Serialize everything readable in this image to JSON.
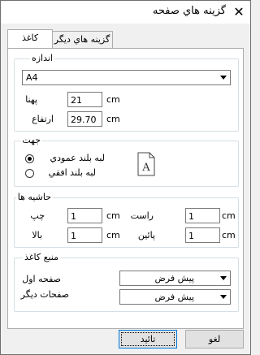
{
  "window": {
    "title": "گزينه هاي صفحه",
    "close_glyph": "✕"
  },
  "tabs": [
    {
      "label": "كاغذ",
      "active": true
    },
    {
      "label": "گزينه هاي ديگر",
      "active": false
    }
  ],
  "size_group": {
    "legend": "اندازه",
    "paper_size": "A4",
    "width_label": "پهنا",
    "width_value": "21",
    "width_unit": "cm",
    "height_label": "ارتفاع",
    "height_value": "29.70",
    "height_unit": "cm"
  },
  "orientation_group": {
    "legend": "جهت",
    "portrait_label": "لبه بلند عمودي",
    "landscape_label": "لبه بلند افقي",
    "selected": "portrait",
    "preview_letter": "A",
    "preview_icon": "page-portrait-icon"
  },
  "margins_group": {
    "legend": "حاشيه ها",
    "right_label": "راست",
    "right_value": "1",
    "left_label": "چپ",
    "left_value": "1",
    "bottom_label": "پائين",
    "bottom_value": "1",
    "top_label": "بالا",
    "top_value": "1",
    "unit": "cm"
  },
  "source_group": {
    "legend": "منبع كاغذ",
    "first_page_label": "صفحه اول",
    "first_page_value": "پيش فرض",
    "other_pages_label": "صفحات ديگر",
    "other_pages_value": "پيش فرض"
  },
  "buttons": {
    "ok_label": "تائيد",
    "cancel_label": "لغو"
  },
  "colors": {
    "default_button_border": "#0078d7",
    "group_border": "#d5dfe5"
  }
}
